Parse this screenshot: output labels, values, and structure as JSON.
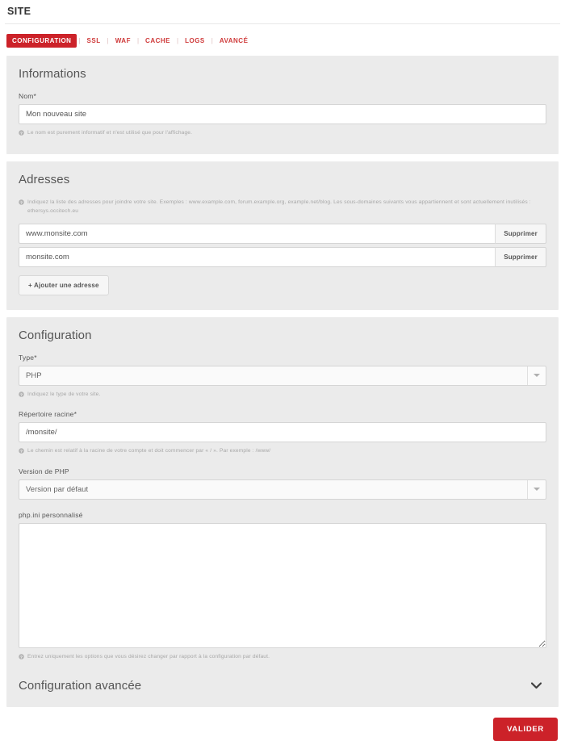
{
  "header": {
    "title": "SITE"
  },
  "tabs": {
    "separator": "|",
    "items": [
      {
        "label": "CONFIGURATION",
        "active": true
      },
      {
        "label": "SSL",
        "active": false
      },
      {
        "label": "WAF",
        "active": false
      },
      {
        "label": "CACHE",
        "active": false
      },
      {
        "label": "LOGS",
        "active": false
      },
      {
        "label": "AVANCÉ",
        "active": false
      }
    ]
  },
  "informations": {
    "heading": "Informations",
    "name_label": "Nom",
    "name_required_mark": "*",
    "name_value": "Mon nouveau site",
    "name_placeholder": "",
    "name_help": "Le nom est purement informatif et n'est utilisé que pour l'affichage."
  },
  "adresses": {
    "heading": "Adresses",
    "help": "Indiquez la liste des adresses pour joindre votre site. Exemples : www.example.com, forum.example.org, example.net/blog. Les sous-domaines suivants vous appartiennent et sont actuellement inutilisés : ethersys.occitech.eu",
    "rows": [
      {
        "value": "www.monsite.com",
        "delete_label": "Supprimer"
      },
      {
        "value": "monsite.com",
        "delete_label": "Supprimer"
      }
    ],
    "add_label": "+ Ajouter une adresse"
  },
  "configuration": {
    "heading": "Configuration",
    "type_label": "Type",
    "type_required_mark": "*",
    "type_value": "PHP",
    "type_help": "Indiquez le type de votre site.",
    "root_label": "Répertoire racine",
    "root_required_mark": "*",
    "root_value": "/monsite/",
    "root_help": "Le chemin est relatif à la racine de votre compte et doit commencer par « / ». Par exemple : /www/",
    "php_version_label": "Version de PHP",
    "php_version_value": "Version par défaut",
    "phpini_label": "php.ini personnalisé",
    "phpini_value": "",
    "phpini_placeholder": "",
    "phpini_help": "Entrez uniquement les options que vous désirez changer par rapport à la configuration par défaut.",
    "advanced_heading": "Configuration avancée",
    "advanced_chevron": "❯"
  },
  "footer": {
    "submit_label": "VALIDER"
  },
  "colors": {
    "brand_red": "#cc2229",
    "tab_red": "#cf3a3a",
    "panel_bg": "#ebebeb",
    "page_bg": "#ffffff",
    "help_text": "#a7a7a7"
  }
}
